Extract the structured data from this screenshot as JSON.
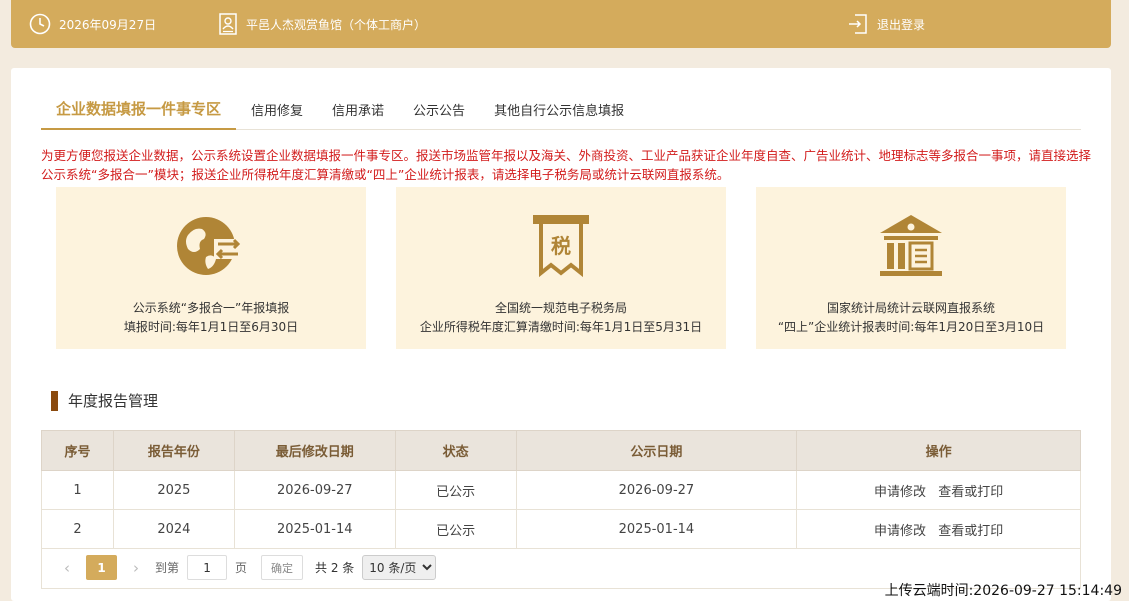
{
  "header": {
    "date": "2026年09月27日",
    "shop_name": "平邑人杰观赏鱼馆（个体工商户）",
    "logout_label": "退出登录",
    "icons": [
      "clock-icon",
      "person-card-icon",
      "logout-icon"
    ],
    "bg_color": "#d4ab5c"
  },
  "tabs": [
    {
      "label": "企业数据填报一件事专区",
      "active": true
    },
    {
      "label": "信用修复",
      "active": false
    },
    {
      "label": "信用承诺",
      "active": false
    },
    {
      "label": "公示公告",
      "active": false
    },
    {
      "label": "其他自行公示信息填报",
      "active": false
    }
  ],
  "notice": "为更方便您报送企业数据，公示系统设置企业数据填报一件事专区。报送市场监管年报以及海关、外商投资、工业产品获证企业年度自查、广告业统计、地理标志等多报合一事项，请直接选择公示系统“多报合一”模块；报送企业所得税年度汇算清缴或“四上”企业统计报表，请选择电子税务局或统计云联网直报系统。",
  "cards": [
    {
      "title": "公示系统“多报合一”年报填报",
      "subtitle": "填报时间:每年1月1日至6月30日",
      "icon": "globe-arrows-icon"
    },
    {
      "title": "全国统一规范电子税务局",
      "subtitle": "企业所得税年度汇算清缴时间:每年1月1日至5月31日",
      "icon": "tax-receipt-icon",
      "icon_text": "税"
    },
    {
      "title": "国家统计局统计云联网直报系统",
      "subtitle": "“四上”企业统计报表时间:每年1月20日至3月10日",
      "icon": "building-icon"
    }
  ],
  "section_title": "年度报告管理",
  "table": {
    "headers": [
      "序号",
      "报告年份",
      "最后修改日期",
      "状态",
      "公示日期",
      "操作"
    ],
    "rows": [
      {
        "no": "1",
        "year": "2025",
        "modified": "2026-09-27",
        "status": "已公示",
        "published": "2026-09-27",
        "action1": "申请修改",
        "action2": "查看或打印"
      },
      {
        "no": "2",
        "year": "2024",
        "modified": "2025-01-14",
        "status": "已公示",
        "published": "2025-01-14",
        "action1": "申请修改",
        "action2": "查看或打印"
      }
    ]
  },
  "pager": {
    "prev": "‹",
    "next": "›",
    "current": "1",
    "goto_label": "到第",
    "goto_value": "1",
    "page_label": "页",
    "confirm_label": "确定",
    "total": "共 2 条",
    "page_size": "10 条/页"
  },
  "upload_time": "上传云端时间:2026-09-27 15:14:49"
}
